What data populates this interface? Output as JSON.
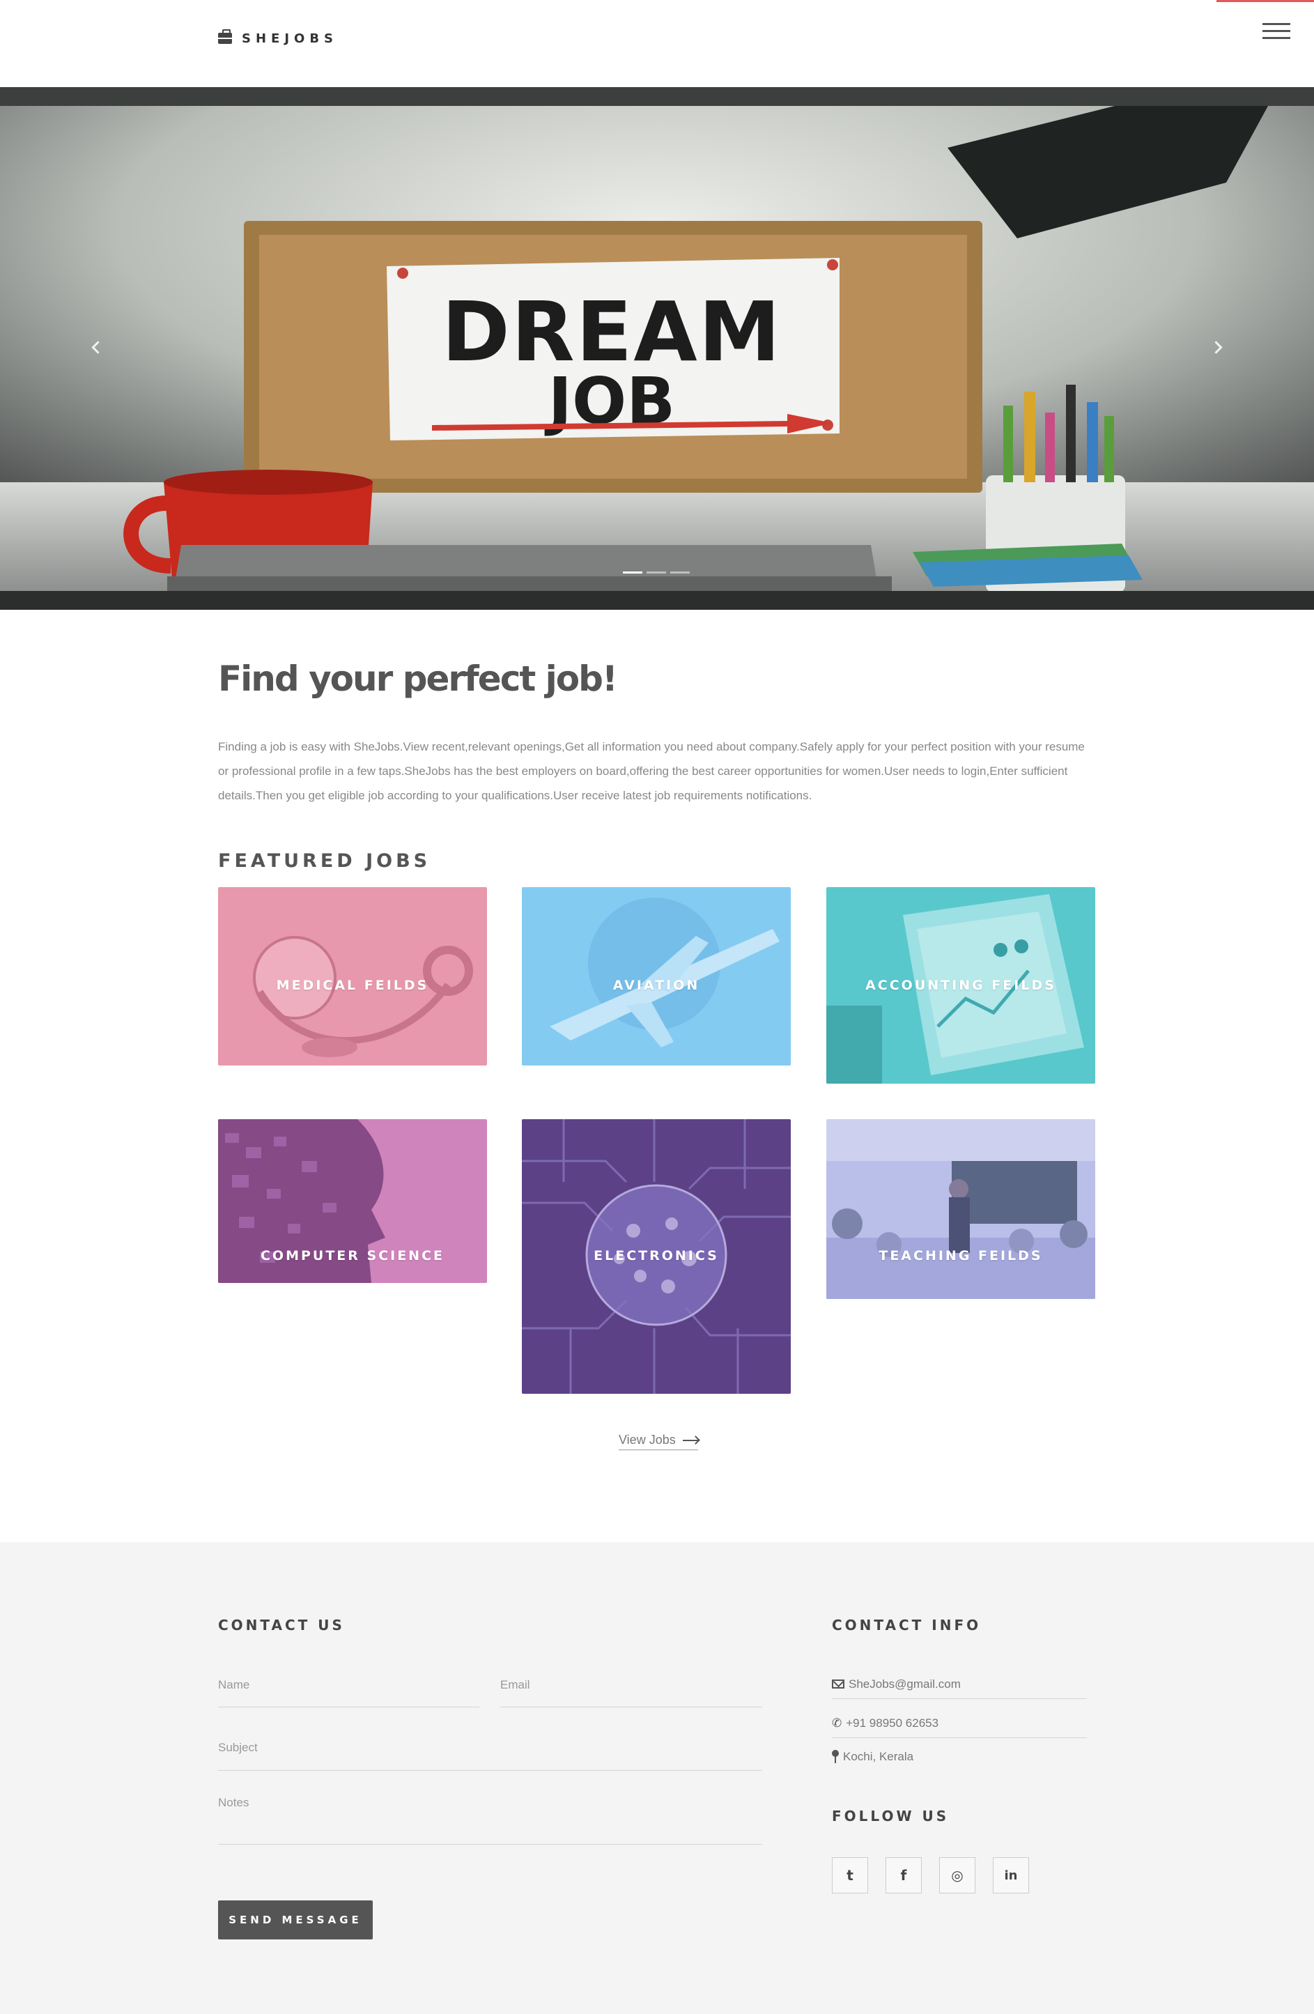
{
  "header": {
    "brand": "SHEJOBS"
  },
  "hero": {
    "slide_text_line1": "DREAM",
    "slide_text_line2": "JOB",
    "slide_count": 3,
    "active_slide": 1
  },
  "intro": {
    "title": "Find your perfect job!",
    "text": "Finding a job is easy with SheJobs.View recent,relevant openings,Get all information you need about company.Safely apply for your perfect position with your resume or professional profile in a few taps.SheJobs has the best employers on board,offering the best career opportunities for women.User needs to login,Enter sufficient details.Then you get eligible job according to your qualifications.User receive latest job requirements notifications."
  },
  "featured": {
    "title": "FEATURED JOBS",
    "cards": [
      {
        "label": "MEDICAL FEILDS",
        "tint": "#e48aa0"
      },
      {
        "label": "AVIATION",
        "tint": "#6cc0ee"
      },
      {
        "label": "ACCOUNTING FEILDS",
        "tint": "#4cc3c8"
      },
      {
        "label": "COMPUTER SCIENCE",
        "tint": "#c664a8"
      },
      {
        "label": "ELECTRONICS",
        "tint": "#6a4a8e"
      },
      {
        "label": "TEACHING FEILDS",
        "tint": "#9aa2e0"
      }
    ],
    "view_jobs": "View Jobs"
  },
  "contact": {
    "title": "CONTACT US",
    "name_placeholder": "Name",
    "email_placeholder": "Email",
    "subject_placeholder": "Subject",
    "notes_placeholder": "Notes",
    "send_label": "SEND MESSAGE"
  },
  "contact_info": {
    "title": "CONTACT INFO",
    "email": "SheJobs@gmail.com",
    "phone": "+91 98950 62653",
    "location": "Kochi, Kerala"
  },
  "follow": {
    "title": "FOLLOW US",
    "links": [
      {
        "icon": "twitter-icon",
        "glyph": "t"
      },
      {
        "icon": "facebook-icon",
        "glyph": "f"
      },
      {
        "icon": "instagram-icon",
        "glyph": "◎"
      },
      {
        "icon": "linkedin-icon",
        "glyph": "in"
      }
    ]
  },
  "colors": {
    "accent": "#e05a5a",
    "button": "#555555",
    "footer_bg": "#f4f4f4"
  }
}
